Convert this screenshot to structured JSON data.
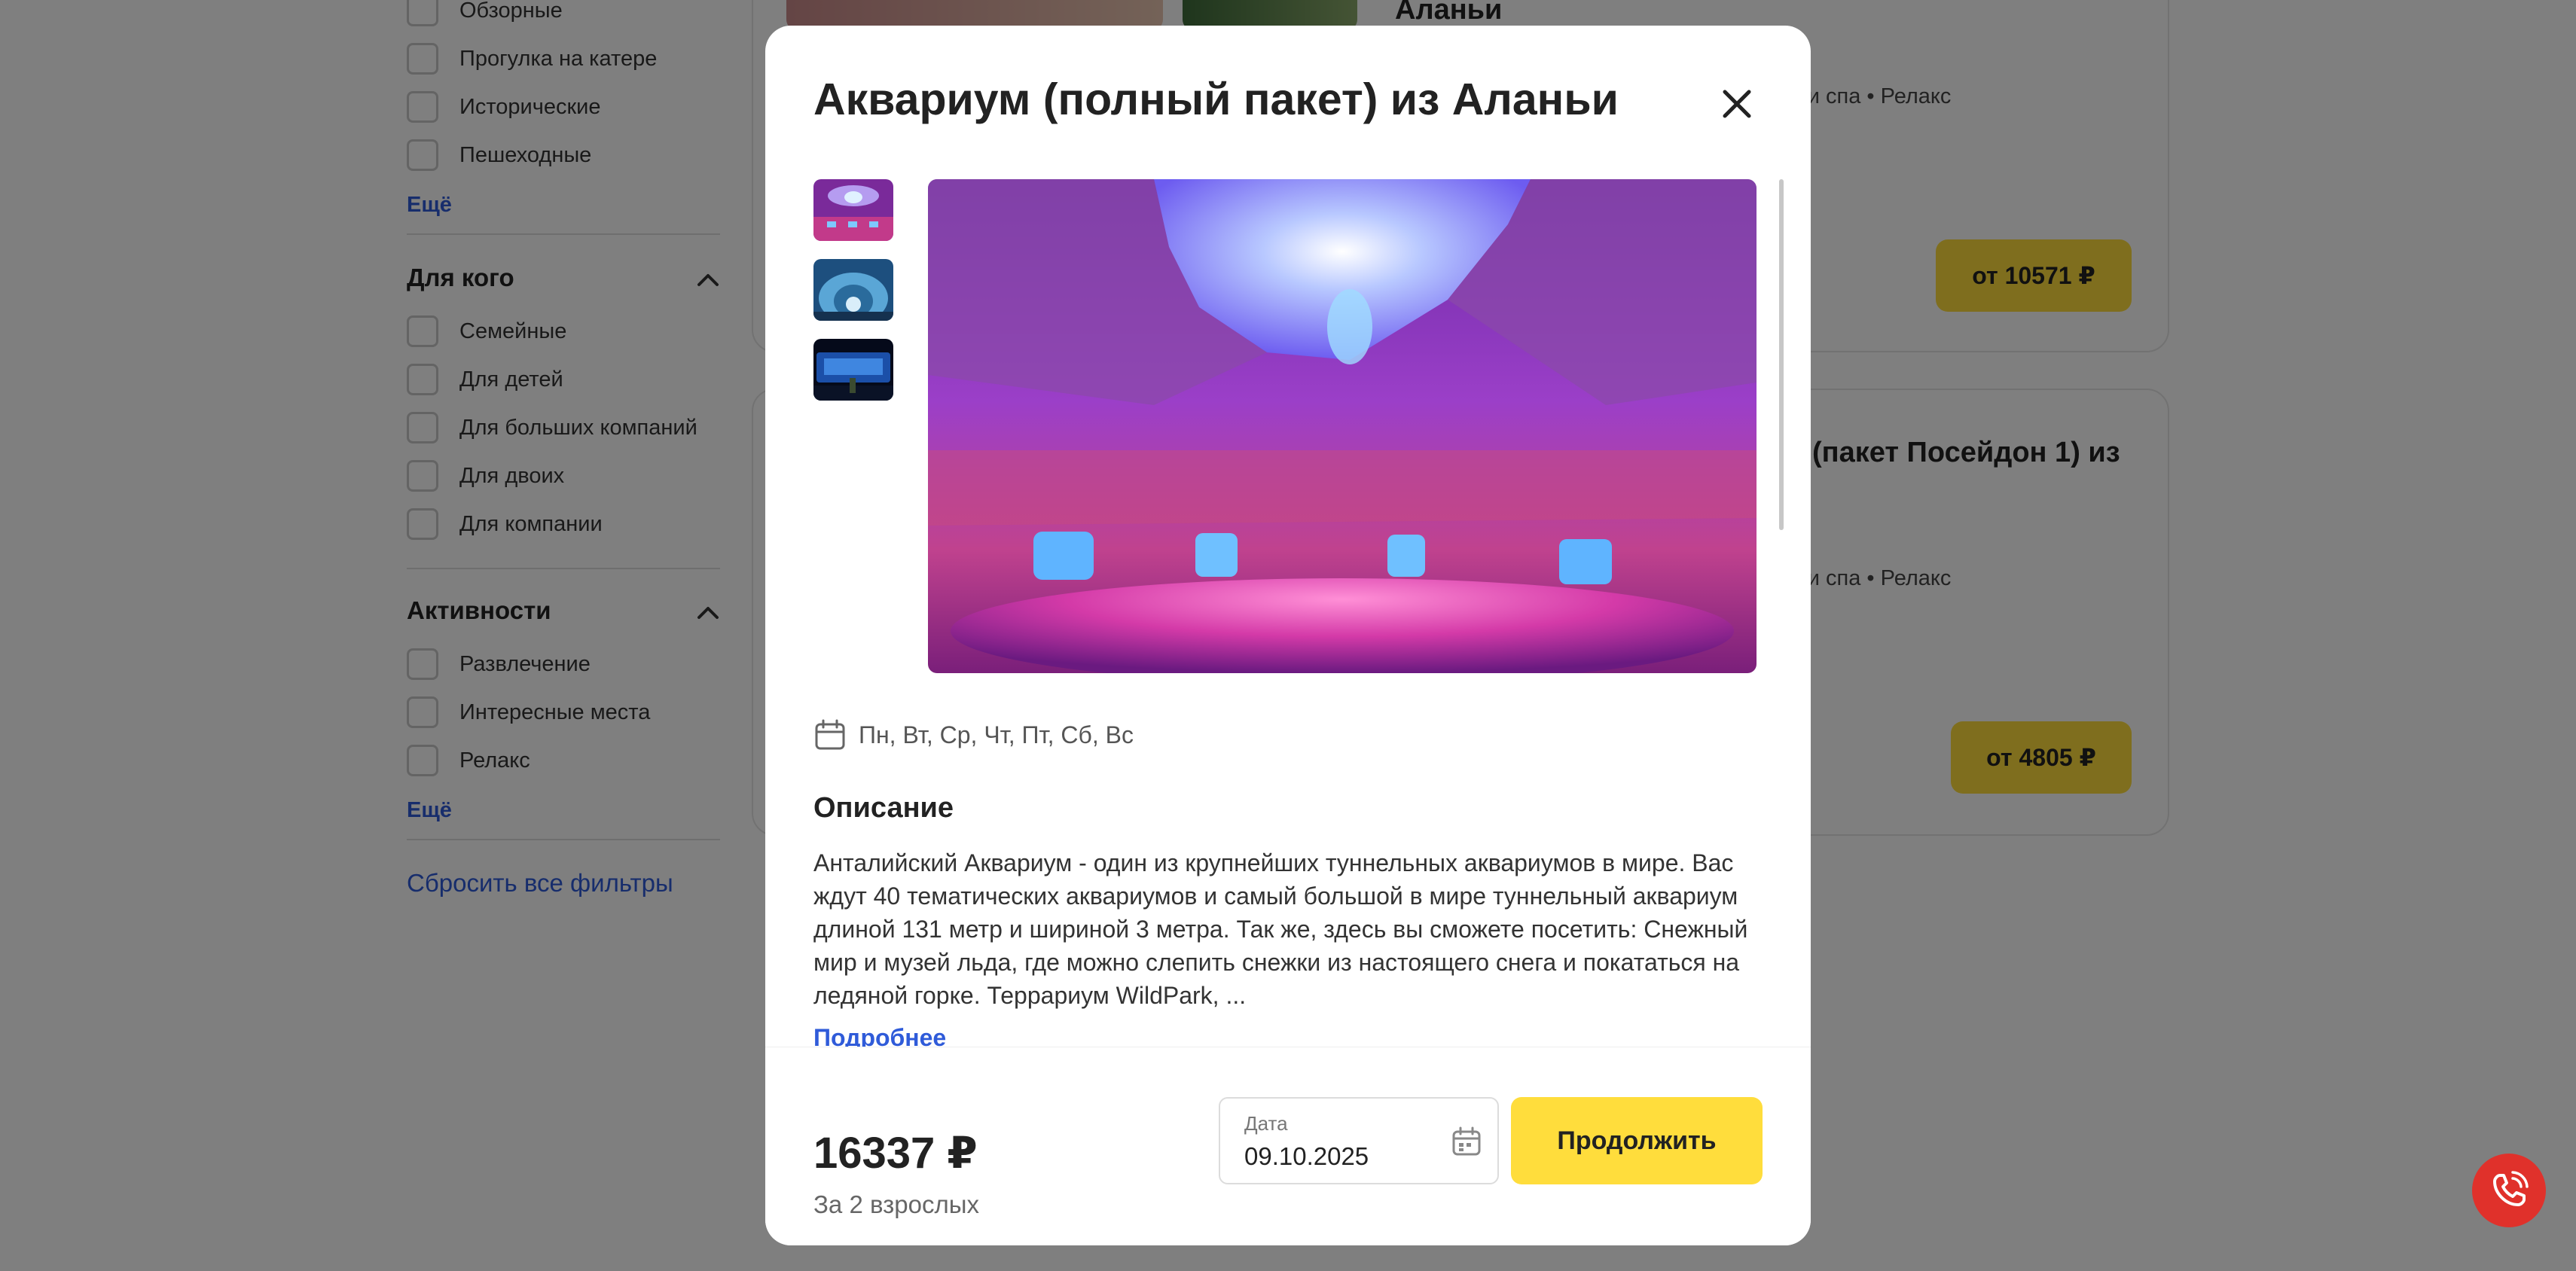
{
  "filters": {
    "type_items": [
      {
        "label": "Обзорные"
      },
      {
        "label": "Прогулка на катере"
      },
      {
        "label": "Исторические"
      },
      {
        "label": "Пешеходные"
      }
    ],
    "type_more": "Ещё",
    "audience": {
      "title": "Для кого",
      "items": [
        {
          "label": "Семейные"
        },
        {
          "label": "Для детей"
        },
        {
          "label": "Для больших компаний"
        },
        {
          "label": "Для двоих"
        },
        {
          "label": "Для компании"
        }
      ]
    },
    "activities": {
      "title": "Активности",
      "items": [
        {
          "label": "Развлечение"
        },
        {
          "label": "Интересные места"
        },
        {
          "label": "Релакс"
        }
      ],
      "more": "Ещё"
    },
    "reset_label": "Сбросить все фильтры"
  },
  "listing": {
    "cards": [
      {
        "title_fragment": "Аланьи",
        "tags": "ня и спа • Релакс",
        "price": "от 10571 ₽"
      },
      {
        "title_fragment": "(пакет Посейдон 1) из",
        "tags": "ня и спа • Релакс",
        "price": "от 4805 ₽"
      }
    ]
  },
  "modal": {
    "title": "Аквариум (полный пакет) из Аланьи",
    "close_icon": "close-icon",
    "schedule": "Пн, Вт, Ср, Чт, Пт, Сб, Вс",
    "description_title": "Описание",
    "description": "Анталийский Аквариум - один из крупнейших туннельных аквариумов в мире. Вас ждут 40 тематических аквариумов и самый большой в мире туннельный аквариум длиной 131 метр и шириной 3 метра. Так же, здесь вы сможете посетить: Снежный мир и музей льда, где можно слепить снежки из настоящего снега и покататься на ледяной горке. Террариум WildPark, ...",
    "more_label": "Подробнее",
    "footer": {
      "price": "16337 ₽",
      "price_note": "За 2 взрослых",
      "date_label": "Дата",
      "date_value": "09.10.2025",
      "continue_label": "Продолжить"
    }
  },
  "colors": {
    "accent_yellow": "#ffdd3c",
    "link_blue": "#2f5bd9",
    "call_red": "#e0312b"
  },
  "icons": {
    "calendar": "calendar-icon",
    "phone": "phone-icon",
    "chevron": "chevron-up-icon"
  }
}
